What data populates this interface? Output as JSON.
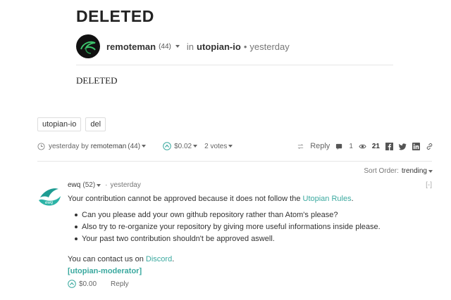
{
  "post": {
    "title": "DELETED",
    "author": "remoteman",
    "reputation": "(44)",
    "category_prefix": "in",
    "category": "utopian-io",
    "separator": "•",
    "time": "yesterday",
    "body": "DELETED"
  },
  "tags": [
    "utopian-io",
    "del"
  ],
  "footer": {
    "time_by": "yesterday by",
    "author": "remoteman",
    "reputation": "(44)",
    "payout": "$0.02",
    "votes": "2 votes",
    "reply_label": "Reply",
    "comments_count": "1",
    "views_count": "21"
  },
  "sort": {
    "label": "Sort Order:",
    "value": "trending"
  },
  "comment": {
    "author": "ewq",
    "reputation": "(52)",
    "separator": "·",
    "time": "yesterday",
    "collapse": "[-]",
    "text_before_link": "Your contribution cannot be approved because it does not follow the",
    "rules_link": "Utopian Rules",
    "text_after_link": ".",
    "list": [
      "Can you please add your own github repository rather than Atom's please?",
      "Also try to re-organize your repository by giving more useful informations inside please.",
      "Your past two contribution shouldn't be approved aswell."
    ],
    "contact_before": "You can contact us on",
    "contact_link": "Discord",
    "contact_after": ".",
    "moderator_tag": "[utopian-moderator]",
    "payout": "$0.00",
    "reply_label": "Reply"
  },
  "colors": {
    "accent": "#3aa99f",
    "avatar_bg": "#111111"
  }
}
